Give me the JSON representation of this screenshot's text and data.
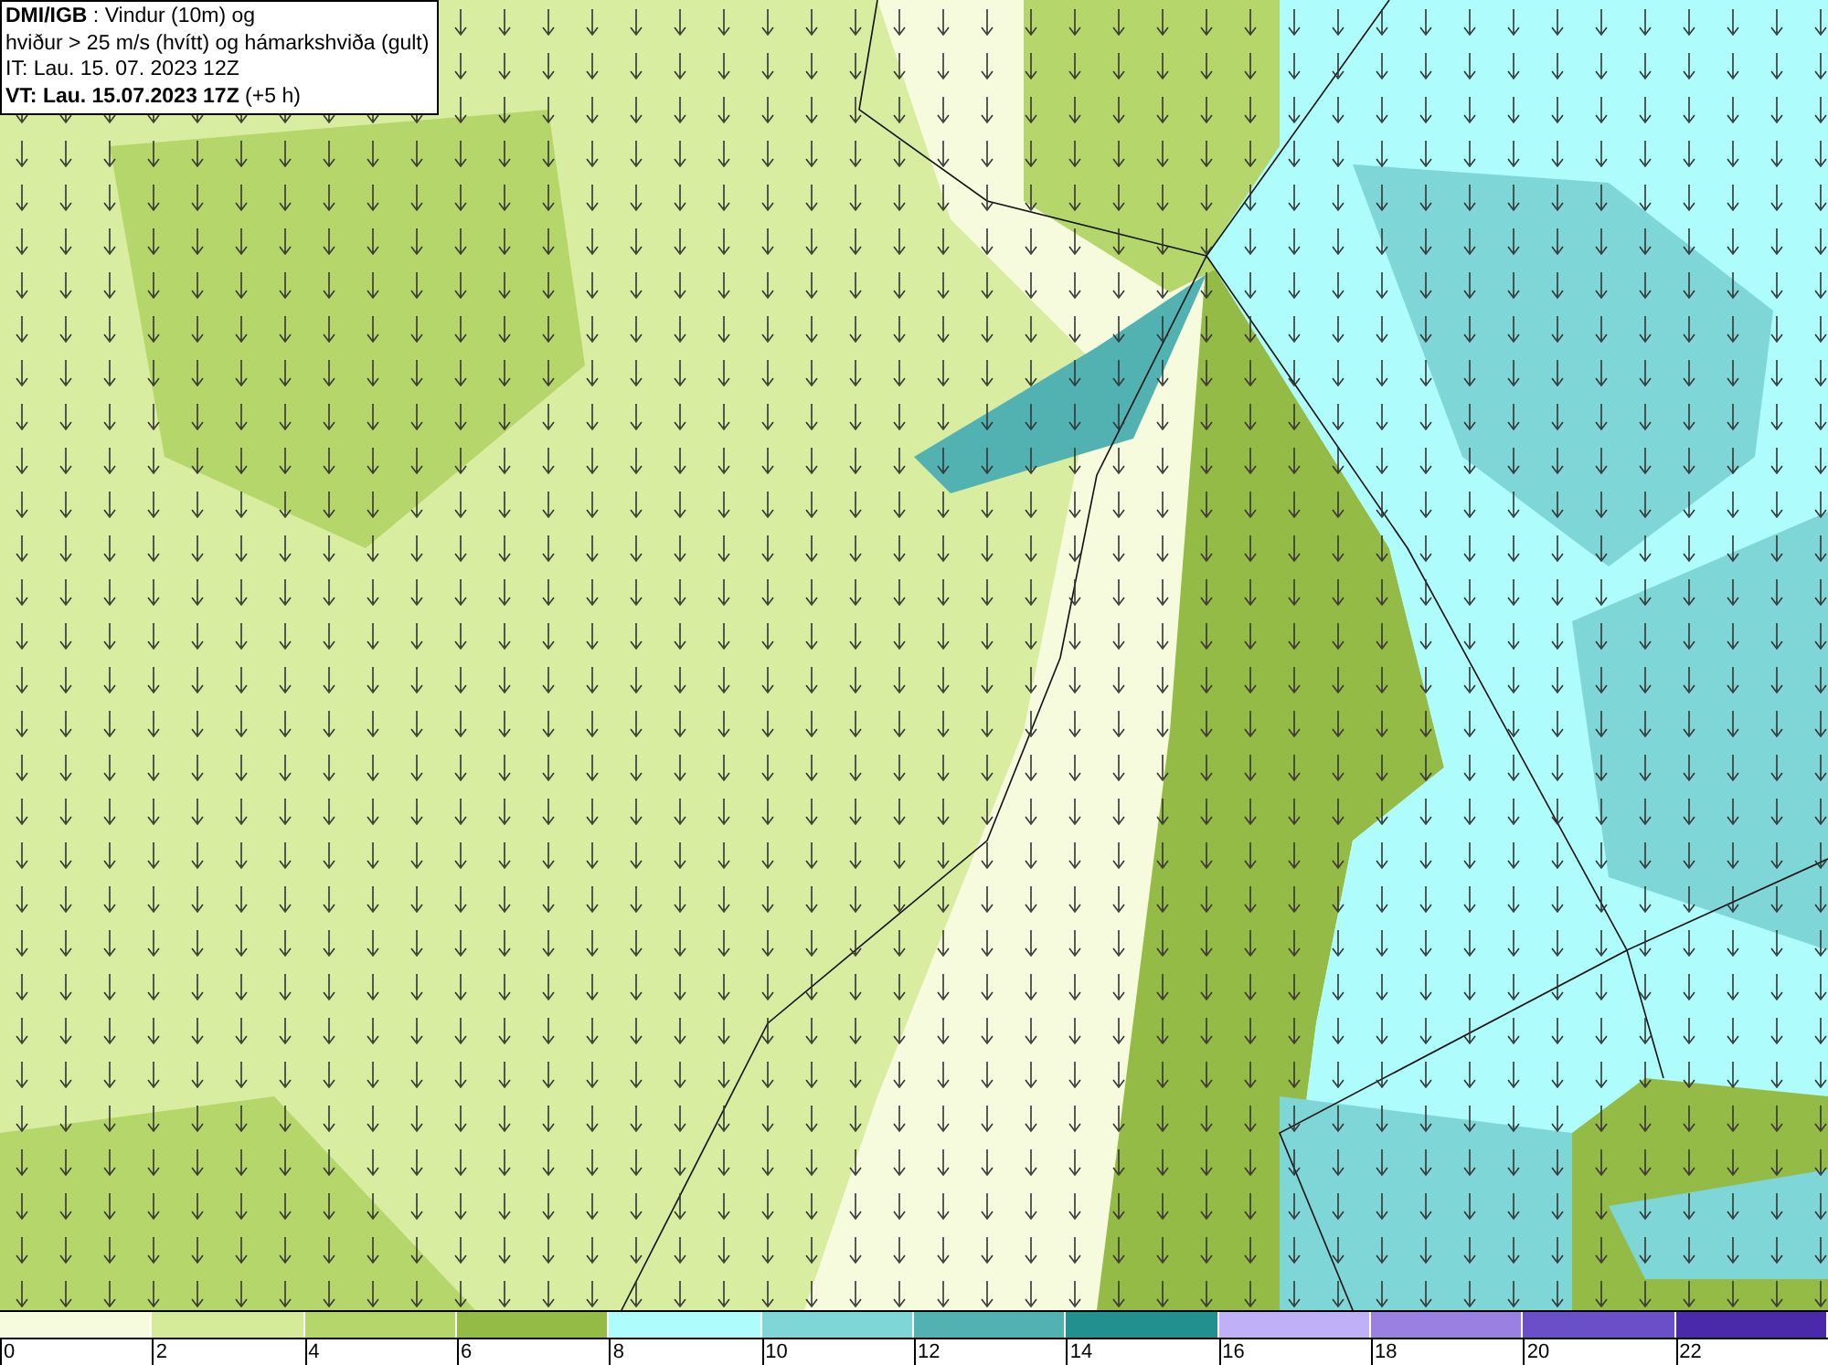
{
  "title_box": {
    "lines": [
      "**DMI/IGB** : Vindur (10m) og",
      "hviður > 25 m/s (hvítt) og hámarkshviða (gult)",
      "IT: Lau. 15. 07. 2023 12Z",
      "**VT: Lau. 15.07.2023 17Z** (+5 h)"
    ]
  },
  "legend": {
    "bins": [
      {
        "label": "0",
        "color": "#f5fbdc"
      },
      {
        "label": "2",
        "color": "#d6eb9a"
      },
      {
        "label": "4",
        "color": "#b5d66a"
      },
      {
        "label": "6",
        "color": "#93bb45"
      },
      {
        "label": "8",
        "color": "#aefcfc"
      },
      {
        "label": "10",
        "color": "#7fd6d6"
      },
      {
        "label": "12",
        "color": "#52b2b2"
      },
      {
        "label": "14",
        "color": "#239090"
      },
      {
        "label": "16",
        "color": "#c0b0f8"
      },
      {
        "label": "18",
        "color": "#9a80e0"
      },
      {
        "label": "20",
        "color": "#6a50c8"
      },
      {
        "label": "22",
        "color": "#4a2aa8"
      }
    ]
  }
}
